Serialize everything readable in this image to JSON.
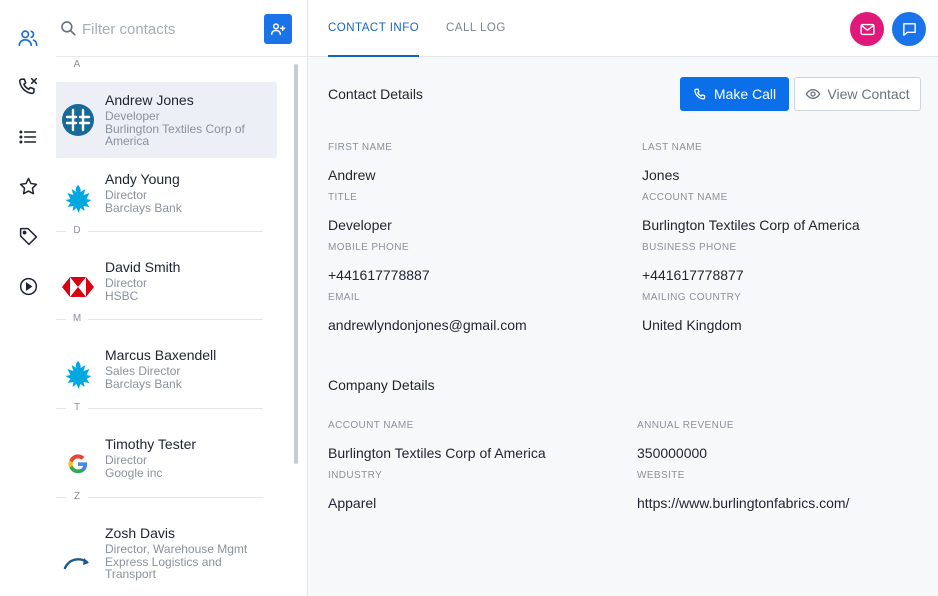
{
  "rail": {
    "items": [
      {
        "icon": "contacts-icon"
      },
      {
        "icon": "missed-call-icon"
      },
      {
        "icon": "list-icon"
      },
      {
        "icon": "star-icon"
      },
      {
        "icon": "tag-icon"
      },
      {
        "icon": "play-icon"
      }
    ]
  },
  "search": {
    "placeholder": "Filter contacts",
    "value": ""
  },
  "contacts": {
    "letters": [
      "A",
      "D",
      "M",
      "T",
      "Z"
    ],
    "items": [
      {
        "name": "Andrew Jones",
        "title": "Developer",
        "company": "Burlington Textiles Corp of America",
        "logo": "burlington-logo-icon",
        "selected": true
      },
      {
        "name": "Andy Young",
        "title": "Director",
        "company": "Barclays Bank",
        "logo": "barclays-eagle-logo-icon"
      },
      {
        "name": "David Smith",
        "title": "Director",
        "company": "HSBC",
        "logo": "hsbc-logo-icon"
      },
      {
        "name": "Marcus Baxendell",
        "title": "Sales Director",
        "company": "Barclays Bank",
        "logo": "barclays-eagle-logo-icon"
      },
      {
        "name": "Timothy Tester",
        "title": "Director",
        "company": "Google inc",
        "logo": "google-logo-icon"
      },
      {
        "name": "Zosh Davis",
        "title": "Director, Warehouse Mgmt",
        "company": "Express Logistics and Transport",
        "logo": "express-logistics-logo-icon"
      }
    ]
  },
  "tabs": [
    {
      "label": "CONTACT INFO",
      "active": true
    },
    {
      "label": "CALL LOG",
      "active": false
    }
  ],
  "colors": {
    "accent": "#1565c0",
    "primary_button": "#0a6fe8",
    "email_button": "#e0187a",
    "chat_button": "#1a73e8"
  },
  "contact_details": {
    "heading": "Contact Details",
    "make_call_label": "Make Call",
    "view_contact_label": "View Contact",
    "fields": {
      "first_name": {
        "label": "FIRST NAME",
        "value": "Andrew"
      },
      "last_name": {
        "label": "LAST NAME",
        "value": "Jones"
      },
      "title": {
        "label": "TITLE",
        "value": "Developer"
      },
      "account_name": {
        "label": "ACCOUNT NAME",
        "value": "Burlington Textiles Corp of America"
      },
      "mobile_phone": {
        "label": "MOBILE PHONE",
        "value": "+441617778887"
      },
      "business_phone": {
        "label": "BUSINESS PHONE",
        "value": "+441617778877"
      },
      "email": {
        "label": "EMAIL",
        "value": "andrewlyndonjones@gmail.com"
      },
      "mailing_country": {
        "label": "MAILING COUNTRY",
        "value": "United Kingdom"
      }
    }
  },
  "company_details": {
    "heading": "Company Details",
    "fields": {
      "account_name": {
        "label": "ACCOUNT NAME",
        "value": "Burlington Textiles Corp of America"
      },
      "annual_revenue": {
        "label": "ANNUAL REVENUE",
        "value": "350000000"
      },
      "industry": {
        "label": "INDUSTRY",
        "value": "Apparel"
      },
      "website": {
        "label": "WEBSITE",
        "value": "https://www.burlingtonfabrics.com/"
      }
    }
  }
}
